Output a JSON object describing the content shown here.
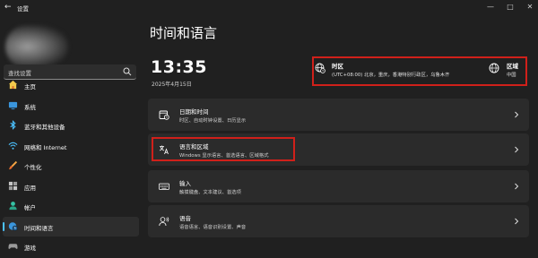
{
  "window": {
    "title": "设置",
    "back_glyph": "←",
    "minimize_glyph": "—",
    "maximize_glyph": "□",
    "close_glyph": "✕"
  },
  "search": {
    "placeholder": "查找设置"
  },
  "sidebar": {
    "items": [
      {
        "label": "主页",
        "icon": "home-icon"
      },
      {
        "label": "系统",
        "icon": "system-icon"
      },
      {
        "label": "蓝牙和其他设备",
        "icon": "bluetooth-icon"
      },
      {
        "label": "网络和 Internet",
        "icon": "wifi-icon"
      },
      {
        "label": "个性化",
        "icon": "brush-icon"
      },
      {
        "label": "应用",
        "icon": "apps-icon"
      },
      {
        "label": "帐户",
        "icon": "account-icon"
      },
      {
        "label": "时间和语言",
        "icon": "globe-clock-icon",
        "active": true
      },
      {
        "label": "游戏",
        "icon": "gaming-icon"
      }
    ]
  },
  "main": {
    "title": "时间和语言",
    "clock": "13:35",
    "date": "2025年4月15日",
    "timezone": {
      "title": "时区",
      "value": "(UTC+08:00) 北京，重庆，香港特别行政区，乌鲁木齐"
    },
    "region": {
      "title": "区域",
      "value": "中国"
    },
    "cards": [
      {
        "title": "日期和时间",
        "subtitle": "时区、自动时钟设置、日历显示",
        "icon": "calendar-clock-icon"
      },
      {
        "title": "语言和区域",
        "subtitle": "Windows 显示语言、首选语言、区域格式",
        "icon": "language-icon"
      },
      {
        "title": "输入",
        "subtitle": "触摸键盘、文本建议、首选项",
        "icon": "keyboard-icon"
      },
      {
        "title": "语音",
        "subtitle": "语音语言、语音识别设置、声音",
        "icon": "speech-icon"
      }
    ]
  },
  "colors": {
    "accent": "#4cc2ff",
    "highlight": "#d0201a",
    "background": "#202020",
    "card": "#2b2b2b"
  }
}
